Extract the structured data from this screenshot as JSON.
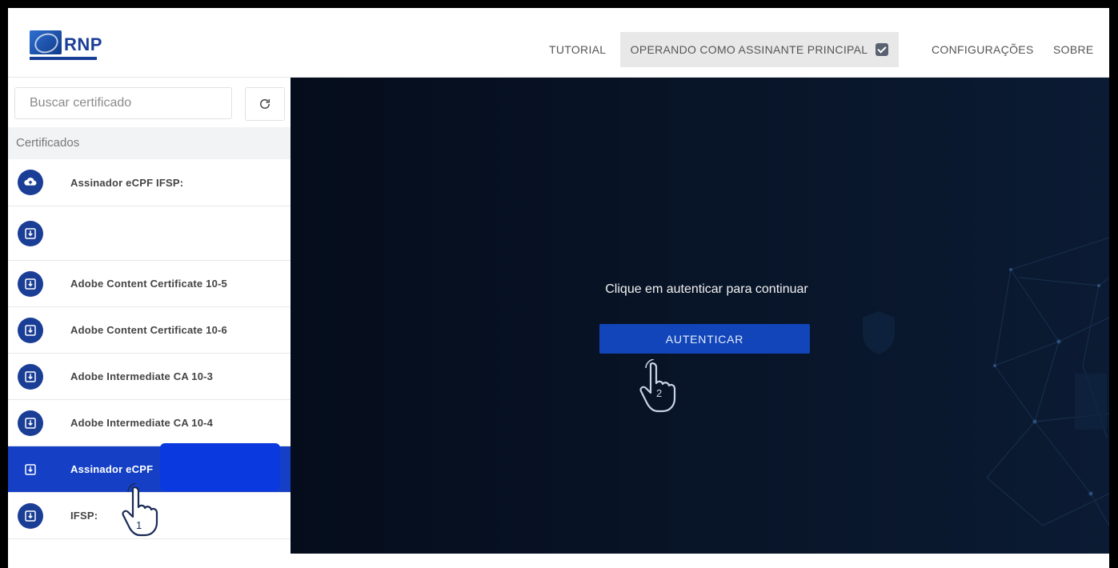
{
  "header": {
    "logo_text": "RNP",
    "nav": {
      "tutorial": "TUTORIAL",
      "operando": "OPERANDO COMO ASSINANTE PRINCIPAL",
      "configuracoes": "CONFIGURAÇÕES",
      "sobre": "SOBRE"
    }
  },
  "sidebar": {
    "search_placeholder": "Buscar certificado",
    "section_label": "Certificados",
    "items": [
      {
        "label": "Assinador eCPF IFSP:",
        "icon": "cloud-upload-icon"
      },
      {
        "label": "",
        "icon": "download-box-icon"
      },
      {
        "label": "Adobe Content Certificate 10-5",
        "icon": "download-box-icon"
      },
      {
        "label": "Adobe Content Certificate 10-6",
        "icon": "download-box-icon"
      },
      {
        "label": "Adobe Intermediate CA 10-3",
        "icon": "download-box-icon"
      },
      {
        "label": "Adobe Intermediate CA 10-4",
        "icon": "download-box-icon"
      },
      {
        "label": "Assinador eCPF",
        "icon": "download-box-icon",
        "selected": true
      },
      {
        "label": "IFSP:",
        "icon": "download-box-icon"
      }
    ]
  },
  "main": {
    "prompt": "Clique em autenticar para continuar",
    "button_label": "AUTENTICAR"
  },
  "annotations": {
    "step1": "1",
    "step2": "2"
  },
  "colors": {
    "brand": "#1a3e96",
    "selected": "#1540c5",
    "main_bg": "#050d1c",
    "button": "#1145b9"
  }
}
